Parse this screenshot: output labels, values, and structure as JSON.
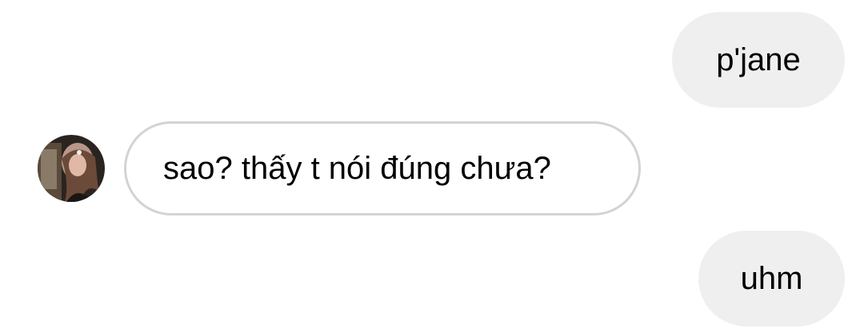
{
  "messages": [
    {
      "direction": "outgoing",
      "text": "p'jane"
    },
    {
      "direction": "incoming",
      "text": "sao? thấy t nói đúng chưa?",
      "avatar": "contact-avatar"
    },
    {
      "direction": "outgoing",
      "text": "uhm"
    }
  ],
  "colors": {
    "outgoing_bubble": "#efefef",
    "incoming_border": "#d3d3d3",
    "text": "#000000",
    "background": "#ffffff"
  }
}
